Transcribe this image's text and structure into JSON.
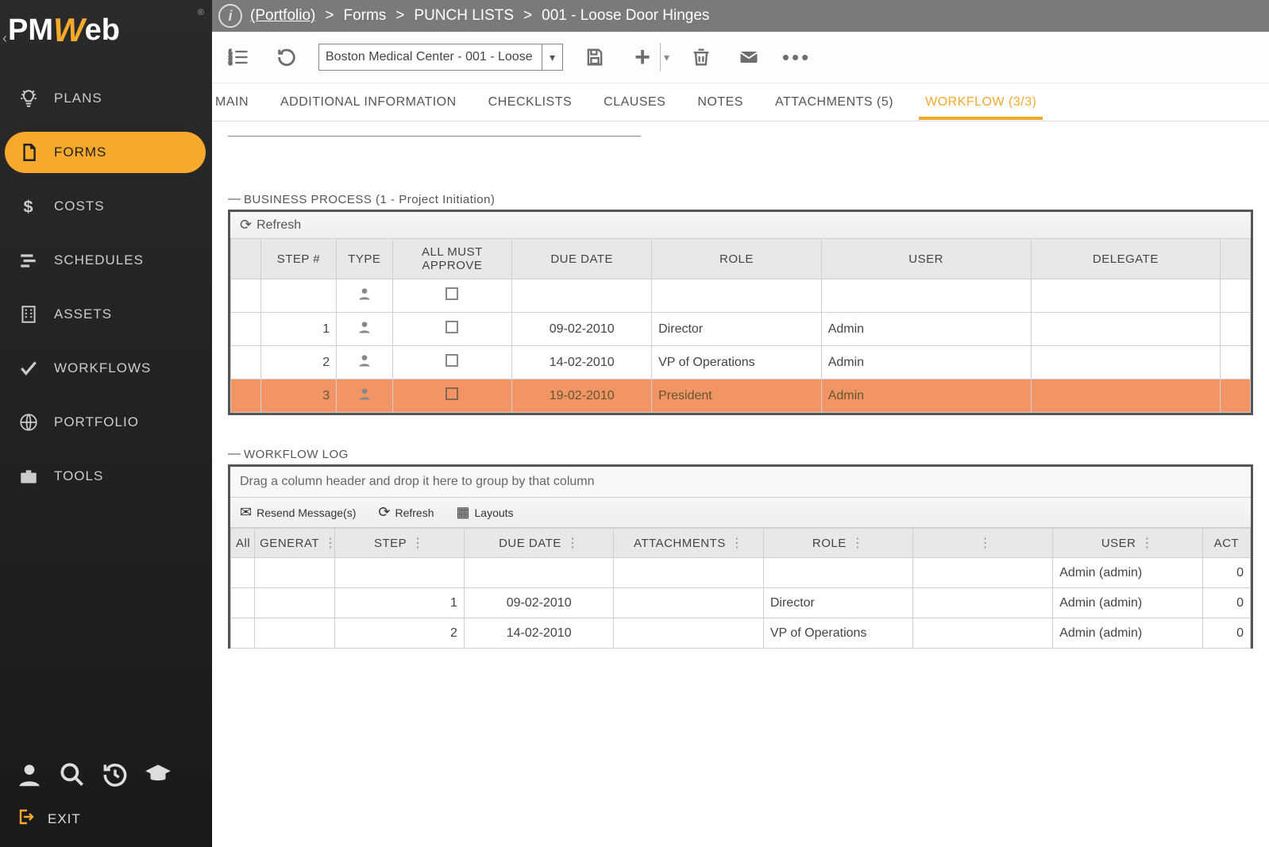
{
  "logo": {
    "left": "PM",
    "right": "eb"
  },
  "sidebar": {
    "collapse_chev": "‹",
    "items": [
      {
        "label": "PLANS"
      },
      {
        "label": "FORMS"
      },
      {
        "label": "COSTS"
      },
      {
        "label": "SCHEDULES"
      },
      {
        "label": "ASSETS"
      },
      {
        "label": "WORKFLOWS"
      },
      {
        "label": "PORTFOLIO"
      },
      {
        "label": "TOOLS"
      }
    ],
    "exit_label": "EXIT"
  },
  "breadcrumb": {
    "portfolio": "(Portfolio)",
    "seg1": "Forms",
    "seg2": "PUNCH LISTS",
    "seg3": "001 - Loose Door Hinges"
  },
  "toolbar": {
    "combo_value": "Boston Medical Center - 001 - Loose"
  },
  "tabs": [
    {
      "label": "MAIN"
    },
    {
      "label": "ADDITIONAL INFORMATION"
    },
    {
      "label": "CHECKLISTS"
    },
    {
      "label": "CLAUSES"
    },
    {
      "label": "NOTES"
    },
    {
      "label": "ATTACHMENTS (5)"
    },
    {
      "label": "WORKFLOW (3/3)"
    }
  ],
  "business_process": {
    "title": "BUSINESS PROCESS (1 - Project Initiation)",
    "refresh": "Refresh",
    "cols": {
      "step": "STEP #",
      "type": "TYPE",
      "approve": "ALL MUST APPROVE",
      "due": "DUE DATE",
      "role": "ROLE",
      "user": "USER",
      "delegate": "DELEGATE"
    },
    "rows": [
      {
        "step": "",
        "due": "",
        "role": "",
        "user": ""
      },
      {
        "step": "1",
        "due": "09-02-2010",
        "role": "Director",
        "user": "Admin"
      },
      {
        "step": "2",
        "due": "14-02-2010",
        "role": "VP of Operations",
        "user": "Admin"
      },
      {
        "step": "3",
        "due": "19-02-2010",
        "role": "President",
        "user": "Admin"
      }
    ]
  },
  "workflow_log": {
    "title": "WORKFLOW LOG",
    "group_hint": "Drag a column header and drop it here to group by that column",
    "actions": {
      "resend": "Resend Message(s)",
      "refresh": "Refresh",
      "layouts": "Layouts"
    },
    "cols": {
      "all": "All",
      "generated": "GENERAT",
      "step": "STEP",
      "due": "DUE DATE",
      "attachments": "ATTACHMENTS",
      "role": "ROLE",
      "blank": "",
      "user": "USER",
      "action": "ACT"
    },
    "rows": [
      {
        "step": "",
        "due": "",
        "role": "",
        "user": "Admin (admin)",
        "act": "0"
      },
      {
        "step": "1",
        "due": "09-02-2010",
        "role": "Director",
        "user": "Admin (admin)",
        "act": "0"
      },
      {
        "step": "2",
        "due": "14-02-2010",
        "role": "VP of Operations",
        "user": "Admin (admin)",
        "act": "0"
      }
    ]
  }
}
